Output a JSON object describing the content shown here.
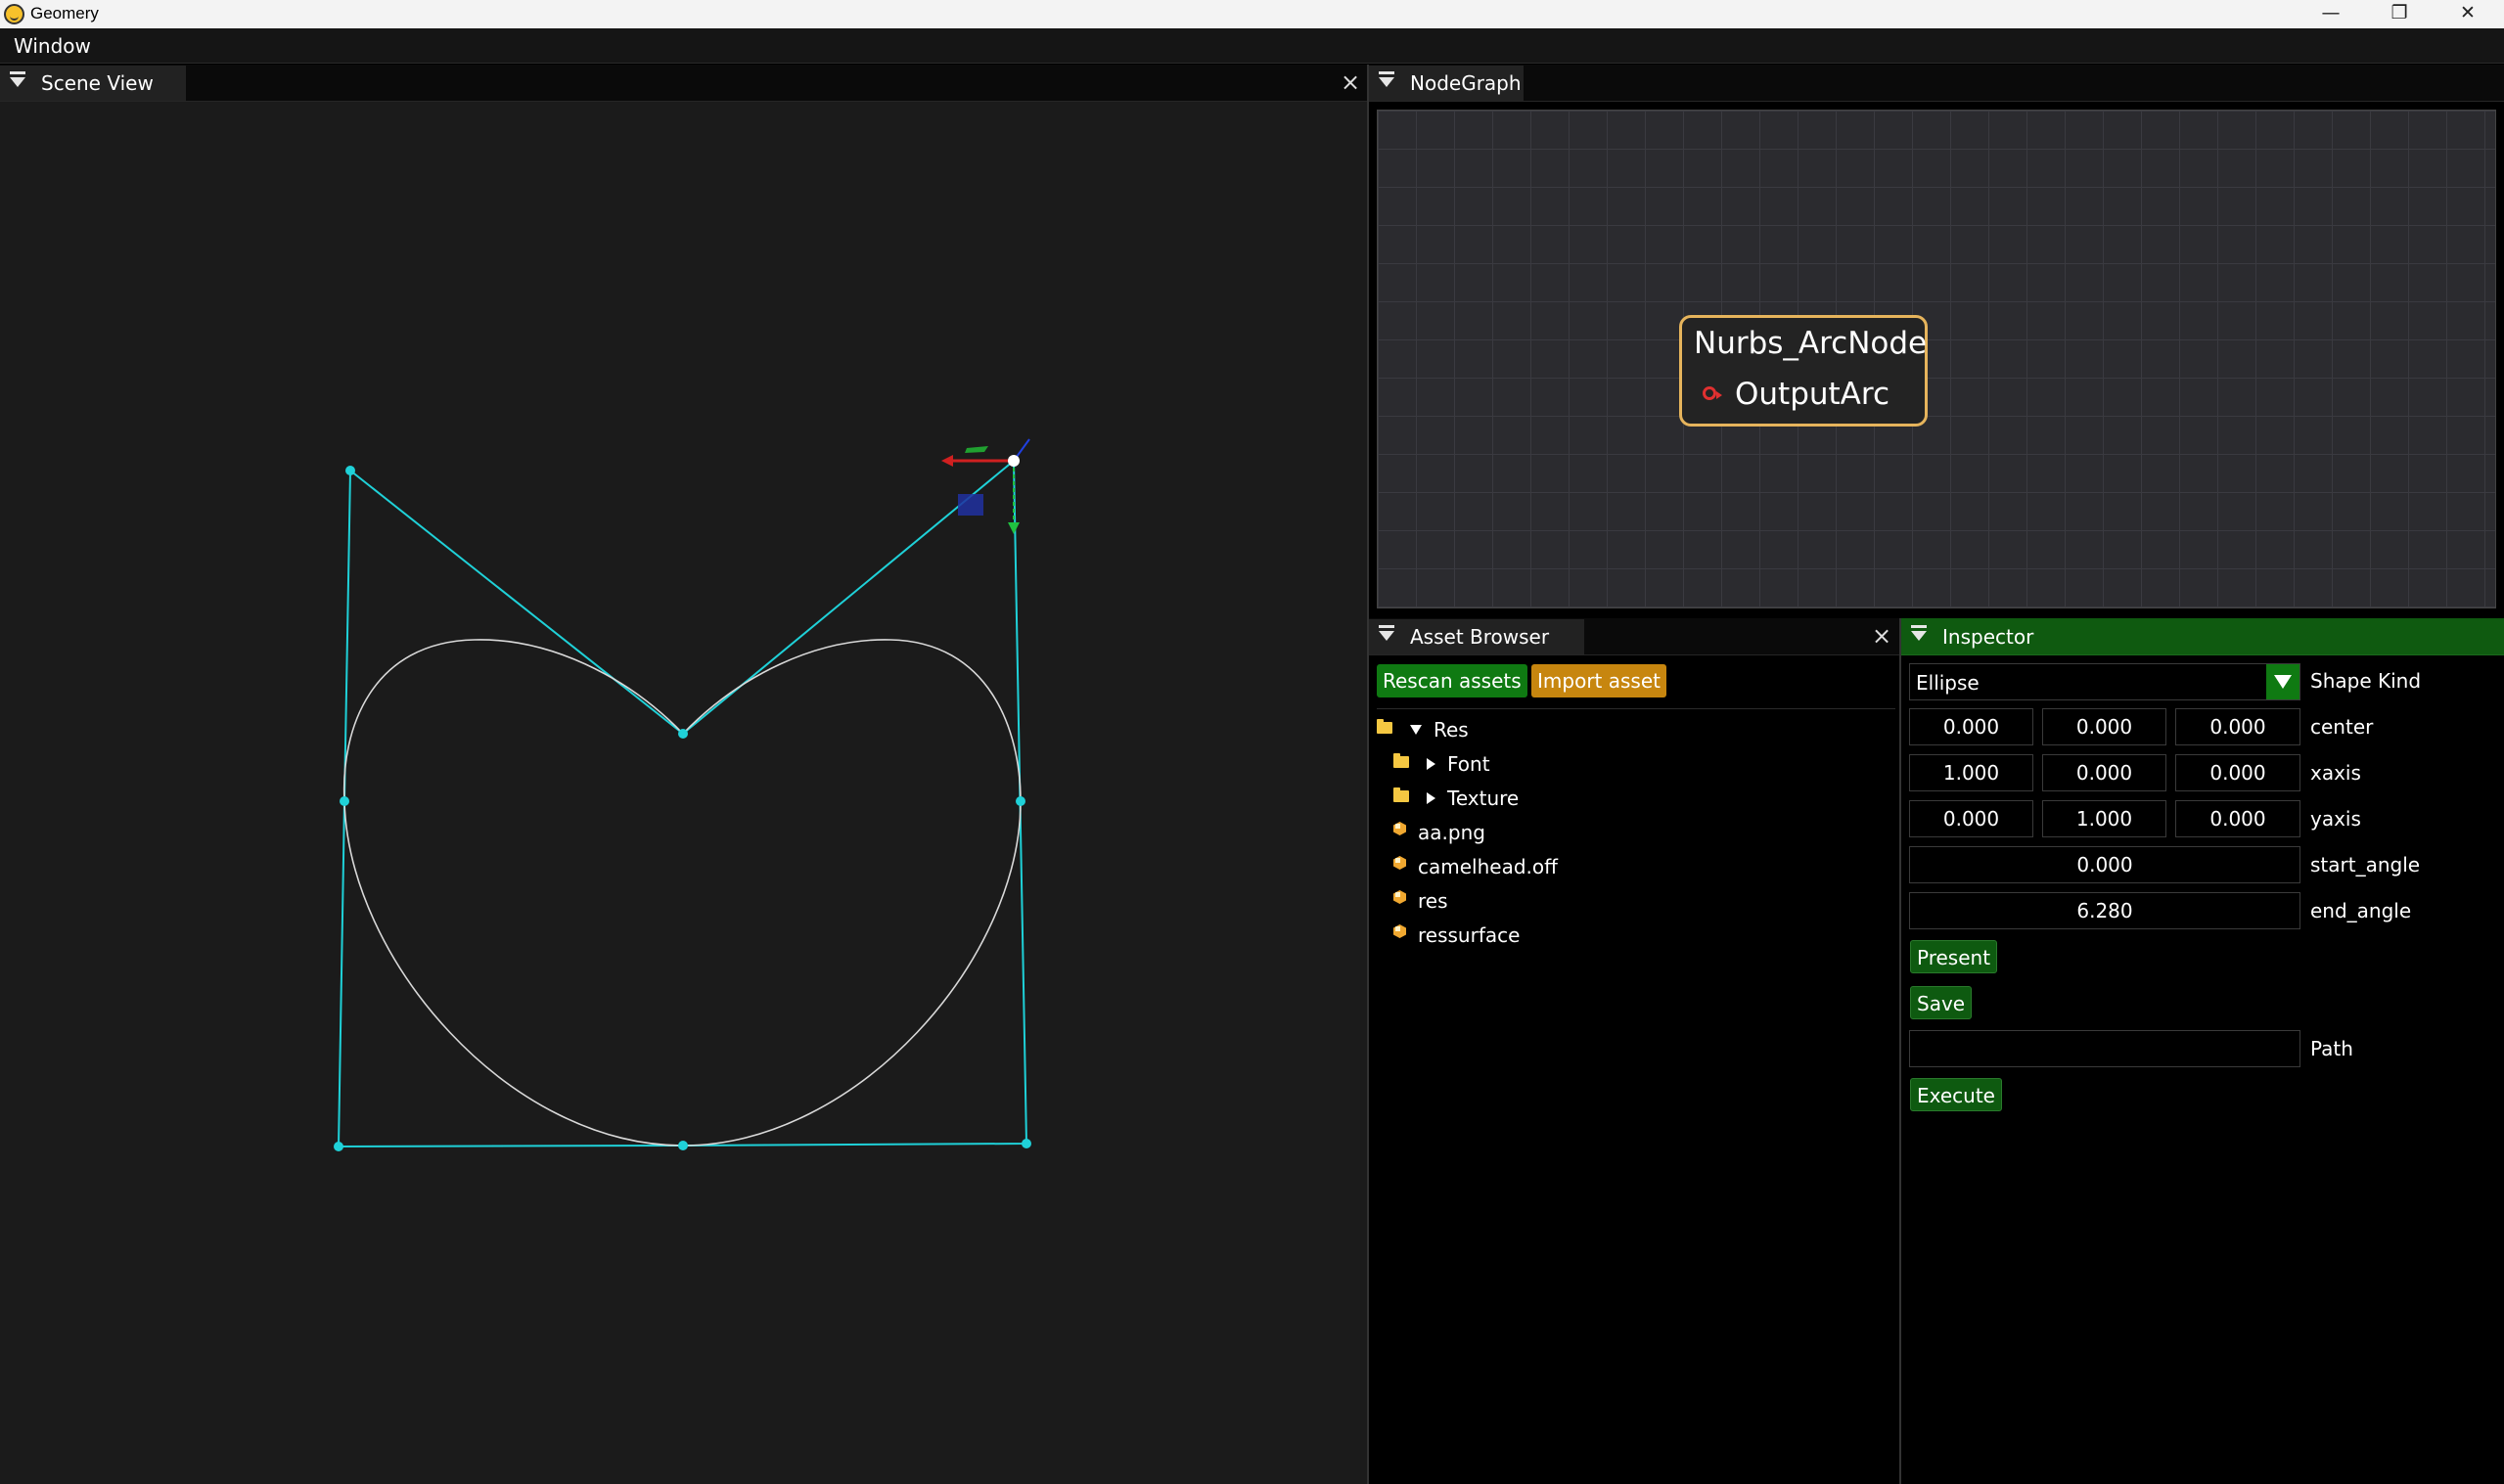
{
  "app": {
    "title": "Geomery"
  },
  "menubar": {
    "items": [
      "Window"
    ]
  },
  "scene_view": {
    "tab_label": "Scene View"
  },
  "node_graph": {
    "tab_label": "NodeGraph",
    "node": {
      "title": "Nurbs_ArcNode",
      "output_pin": "OutputArc"
    }
  },
  "asset_browser": {
    "tab_label": "Asset Browser",
    "rescan_label": "Rescan assets",
    "import_label": "Import asset",
    "tree": {
      "root": "Res",
      "folders": [
        "Font",
        "Texture"
      ],
      "files": [
        "aa.png",
        "camelhead.off",
        "res",
        "ressurface"
      ]
    }
  },
  "inspector": {
    "tab_label": "Inspector",
    "shape_kind": {
      "value": "Ellipse",
      "label": "Shape Kind"
    },
    "center": {
      "label": "center",
      "values": [
        "0.000",
        "0.000",
        "0.000"
      ]
    },
    "xaxis": {
      "label": "xaxis",
      "values": [
        "1.000",
        "0.000",
        "0.000"
      ]
    },
    "yaxis": {
      "label": "yaxis",
      "values": [
        "0.000",
        "1.000",
        "0.000"
      ]
    },
    "start_angle": {
      "label": "start_angle",
      "value": "0.000"
    },
    "end_angle": {
      "label": "end_angle",
      "value": "6.280"
    },
    "present_label": "Present",
    "save_label": "Save",
    "path": {
      "label": "Path",
      "value": ""
    },
    "execute_label": "Execute"
  },
  "colors": {
    "control_polygon": "#1fd1d8",
    "curve": "#d9d9d9",
    "node_border": "#e6b45c",
    "inspector_header": "#0f5a10",
    "button_green": "#0f7a12",
    "button_orange": "#c7860f"
  }
}
